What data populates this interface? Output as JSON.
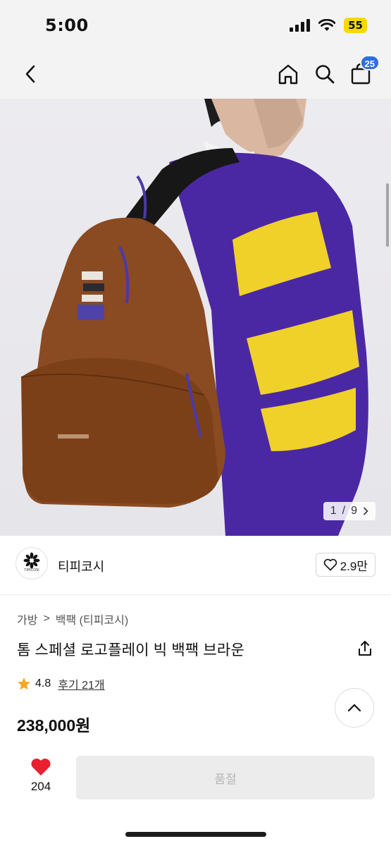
{
  "status_bar": {
    "time": "5:00",
    "battery": "55"
  },
  "header": {
    "cart_count": "25"
  },
  "gallery": {
    "current": "1",
    "separator": "/",
    "total": "9"
  },
  "brand": {
    "name": "티피코시",
    "logo_text": "TIPICOSI",
    "likes": "2.9만"
  },
  "breadcrumb": {
    "category": "가방",
    "separator": ">",
    "subcategory": "백팩 (티피코시)"
  },
  "product": {
    "title": "톰 스페셜 로고플레이 빅 백팩 브라운",
    "rating": "4.8",
    "reviews": "후기 21개",
    "price": "238,000원"
  },
  "bottom_bar": {
    "wish_count": "204",
    "soldout_label": "품절"
  },
  "colors": {
    "accent": "#2f6de1",
    "star": "#f5a623",
    "heart": "#e8202f",
    "battery": "#f5d900"
  }
}
